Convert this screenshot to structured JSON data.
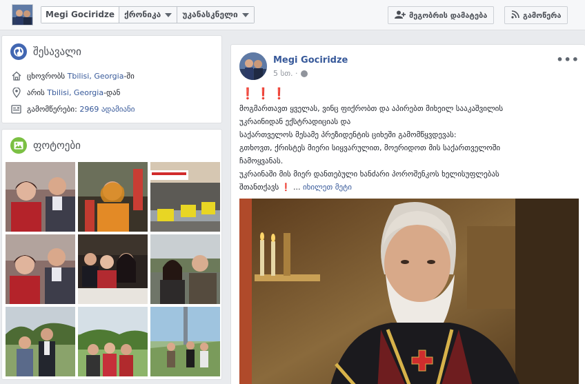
{
  "topbar": {
    "profile_name": "Megi Gociridze",
    "timeline_label": "ქრონიკა",
    "recent_label": "უკანასკნელი",
    "add_friend_label": "მეგობრის დამატება",
    "follow_label": "გამოწერა"
  },
  "intro": {
    "title": "შესავალი",
    "lives_prefix": "ცხოვრობს ",
    "lives_city": "Tbilisi, Georgia",
    "lives_suffix": "-ში",
    "from_prefix": "არის ",
    "from_city": "Tbilisi, Georgia",
    "from_suffix": "-დან",
    "followers_prefix": "გამომწერები: ",
    "followers_count": "2969 ადამიანი"
  },
  "photos": {
    "title": "ფოტოები"
  },
  "post": {
    "author": "Megi Gociridze",
    "time": "5 სთ. ·",
    "marks": "❗❗❗",
    "lines": [
      "მოგმართავთ ყველას, ვინც ფიქრობთ და აპირებთ მიხეილ სააკაშვილის",
      "უკრაინიდან ექსტრადიციას და",
      "საქართველოს მესამე პრეზიდენტის ციხეში გამომწყვდევას:",
      "გთხოვთ, ქრისტეს მიერი სიყვარულით, მოერიდოთ მის საქართველოში",
      "ჩამოყვანას.",
      "უკრაინაში მის მიერ დანთებული ხანძარი პოროშენკოს ხელისუფლებას"
    ],
    "last_line": "შთანთქავს",
    "last_mark": "❗",
    "ellipsis": "...",
    "see_more": "იხილეთ მეტი"
  },
  "colors": {
    "link": "#365899",
    "accent_red": "#d42020",
    "topbar_bg": "#f6f7f9",
    "page_bg": "#e9ebee"
  }
}
